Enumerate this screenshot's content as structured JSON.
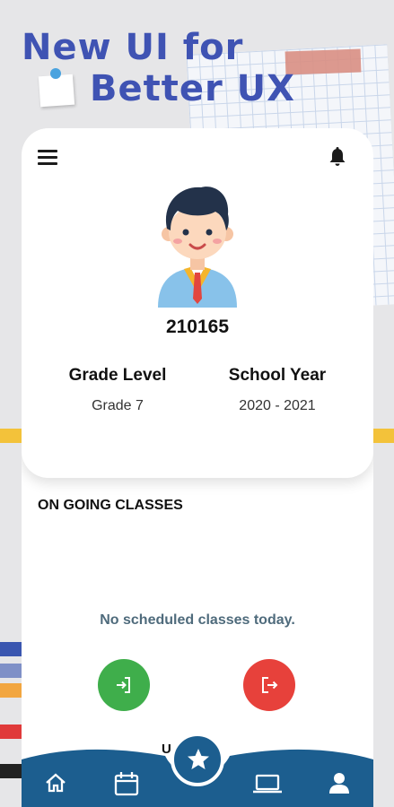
{
  "banner": {
    "line1": "New UI for",
    "line2": "Better UX"
  },
  "header": {
    "menu_icon": "hamburger-menu-icon",
    "bell_icon": "bell-icon"
  },
  "profile": {
    "student_id": "210165",
    "grade_level_label": "Grade Level",
    "grade_level_value": "Grade 7",
    "school_year_label": "School Year",
    "school_year_value": "2020 - 2021"
  },
  "classes": {
    "title": "ON GOING CLASSES",
    "empty_message": "No scheduled classes today.",
    "peek_text": "U"
  },
  "actions": {
    "login_icon": "log-in-icon",
    "logout_icon": "log-out-icon"
  },
  "bottom_nav": {
    "items": [
      "home-icon",
      "calendar-icon",
      "star-icon",
      "laptop-icon",
      "user-icon"
    ]
  },
  "colors": {
    "brand_blue": "#1c5e8f",
    "check_in_green": "#3fae4b",
    "check_out_red": "#e7413b",
    "banner_text": "#3f53b3",
    "empty_text": "#4f6b7c"
  }
}
